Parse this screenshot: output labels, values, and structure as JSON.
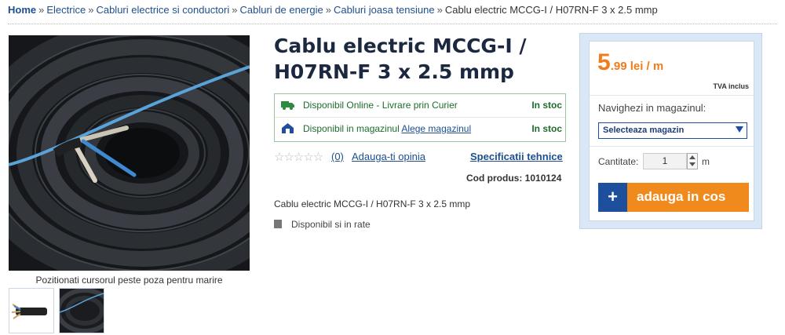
{
  "breadcrumb": {
    "home": "Home",
    "sep": "»",
    "items": [
      "Electrice",
      "Cabluri electrice si conductori",
      "Cabluri de energie",
      "Cabluri joasa tensiune"
    ],
    "current": "Cablu electric MCCG-I / H07RN-F 3 x 2.5 mmp"
  },
  "gallery": {
    "caption": "Pozitionati cursorul peste poza pentru marire"
  },
  "product": {
    "title": "Cablu electric MCCG-I / H07RN-F 3 x 2.5 mmp",
    "availability": {
      "online_text": "Disponibil Online - Livrare prin Curier",
      "online_status": "In stoc",
      "store_text": "Disponibil in magazinul",
      "store_link": "Alege magazinul",
      "store_status": "In stoc"
    },
    "stars": "☆☆☆☆☆",
    "rating_count": "(0)",
    "review_link": "Adauga-ti opinia",
    "spec_link": "Specificatii tehnice",
    "code_label": "Cod produs:",
    "code_value": "1010124",
    "description": "Cablu electric MCCG-I / H07RN-F 3 x 2.5 mmp",
    "installments": "Disponibil si in rate"
  },
  "buybox": {
    "price_int": "5",
    "price_rest": ".99 lei / m",
    "tva": "TVA inclus",
    "nav_label": "Navighezi in magazinul:",
    "store_select": "Selecteaza magazin",
    "qty_label": "Cantitate:",
    "qty_value": "1",
    "qty_unit": "m",
    "cart_plus": "+",
    "cart_label": "adauga in cos"
  },
  "colors": {
    "accent_orange": "#f07c1a",
    "link_blue": "#1d4f8f",
    "stock_green": "#1d6c2c"
  }
}
